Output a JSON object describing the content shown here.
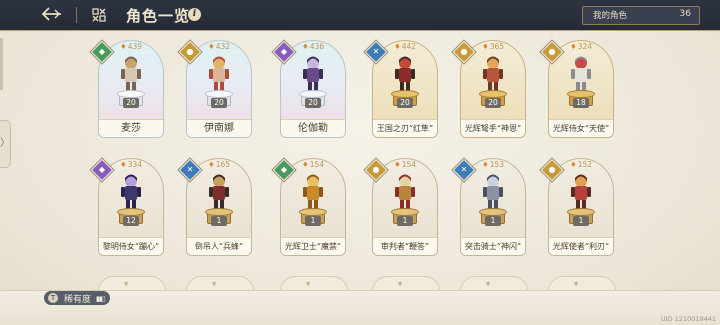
{
  "header": {
    "back_icon": "back-arrow-icon",
    "grid_icon": "grid-view-icon",
    "title": "角色一览",
    "info_icon": "i",
    "count_label": "我的角色",
    "count_value": "36"
  },
  "colors": {
    "header_bg": "#2e3442",
    "accent_gold": "#b8a274",
    "class_green": "#4a9a5e",
    "class_purple": "#8a5cc0",
    "class_gold": "#c79a3a",
    "class_blue": "#3f7bb8"
  },
  "cards": [
    {
      "name": "麦莎",
      "power": "439",
      "level": "20",
      "rarity": "ssr",
      "class": "green",
      "class_glyph": "◆"
    },
    {
      "name": "伊南娜",
      "power": "432",
      "level": "20",
      "rarity": "ssr",
      "class": "gold",
      "class_glyph": "●"
    },
    {
      "name": "伦伽勒",
      "power": "436",
      "level": "20",
      "rarity": "ssr",
      "class": "purple",
      "class_glyph": "◆"
    },
    {
      "name": "王国之刃“红隼”",
      "power": "442",
      "level": "20",
      "rarity": "sr",
      "class": "blue",
      "class_glyph": "✕"
    },
    {
      "name": "光辉弩手“神恩”",
      "power": "365",
      "level": "20",
      "rarity": "sr",
      "class": "gold",
      "class_glyph": "●"
    },
    {
      "name": "光辉侍女“天使”",
      "power": "324",
      "level": "18",
      "rarity": "sr",
      "class": "gold",
      "class_glyph": "●"
    },
    {
      "name": "黎明侍女“蹦心”",
      "power": "334",
      "level": "12",
      "rarity": "r",
      "class": "purple",
      "class_glyph": "◆"
    },
    {
      "name": "倒吊人“兵蜂”",
      "power": "165",
      "level": "1",
      "rarity": "r",
      "class": "blue",
      "class_glyph": "✕"
    },
    {
      "name": "光辉卫士“魔禁”",
      "power": "154",
      "level": "1",
      "rarity": "r",
      "class": "green",
      "class_glyph": "◆"
    },
    {
      "name": "审判者“鞭答”",
      "power": "154",
      "level": "1",
      "rarity": "r",
      "class": "gold",
      "class_glyph": "●"
    },
    {
      "name": "突击骑士“神闪”",
      "power": "153",
      "level": "1",
      "rarity": "r",
      "class": "blue",
      "class_glyph": "✕"
    },
    {
      "name": "光辉使者“利刃”",
      "power": "152",
      "level": "1",
      "rarity": "r",
      "class": "gold",
      "class_glyph": "●"
    }
  ],
  "bottom": {
    "sort_key_icon": "T",
    "sort_label": "稀有度",
    "sort_icon": "sort-bars-icon",
    "uid": "UID 1210019441"
  }
}
